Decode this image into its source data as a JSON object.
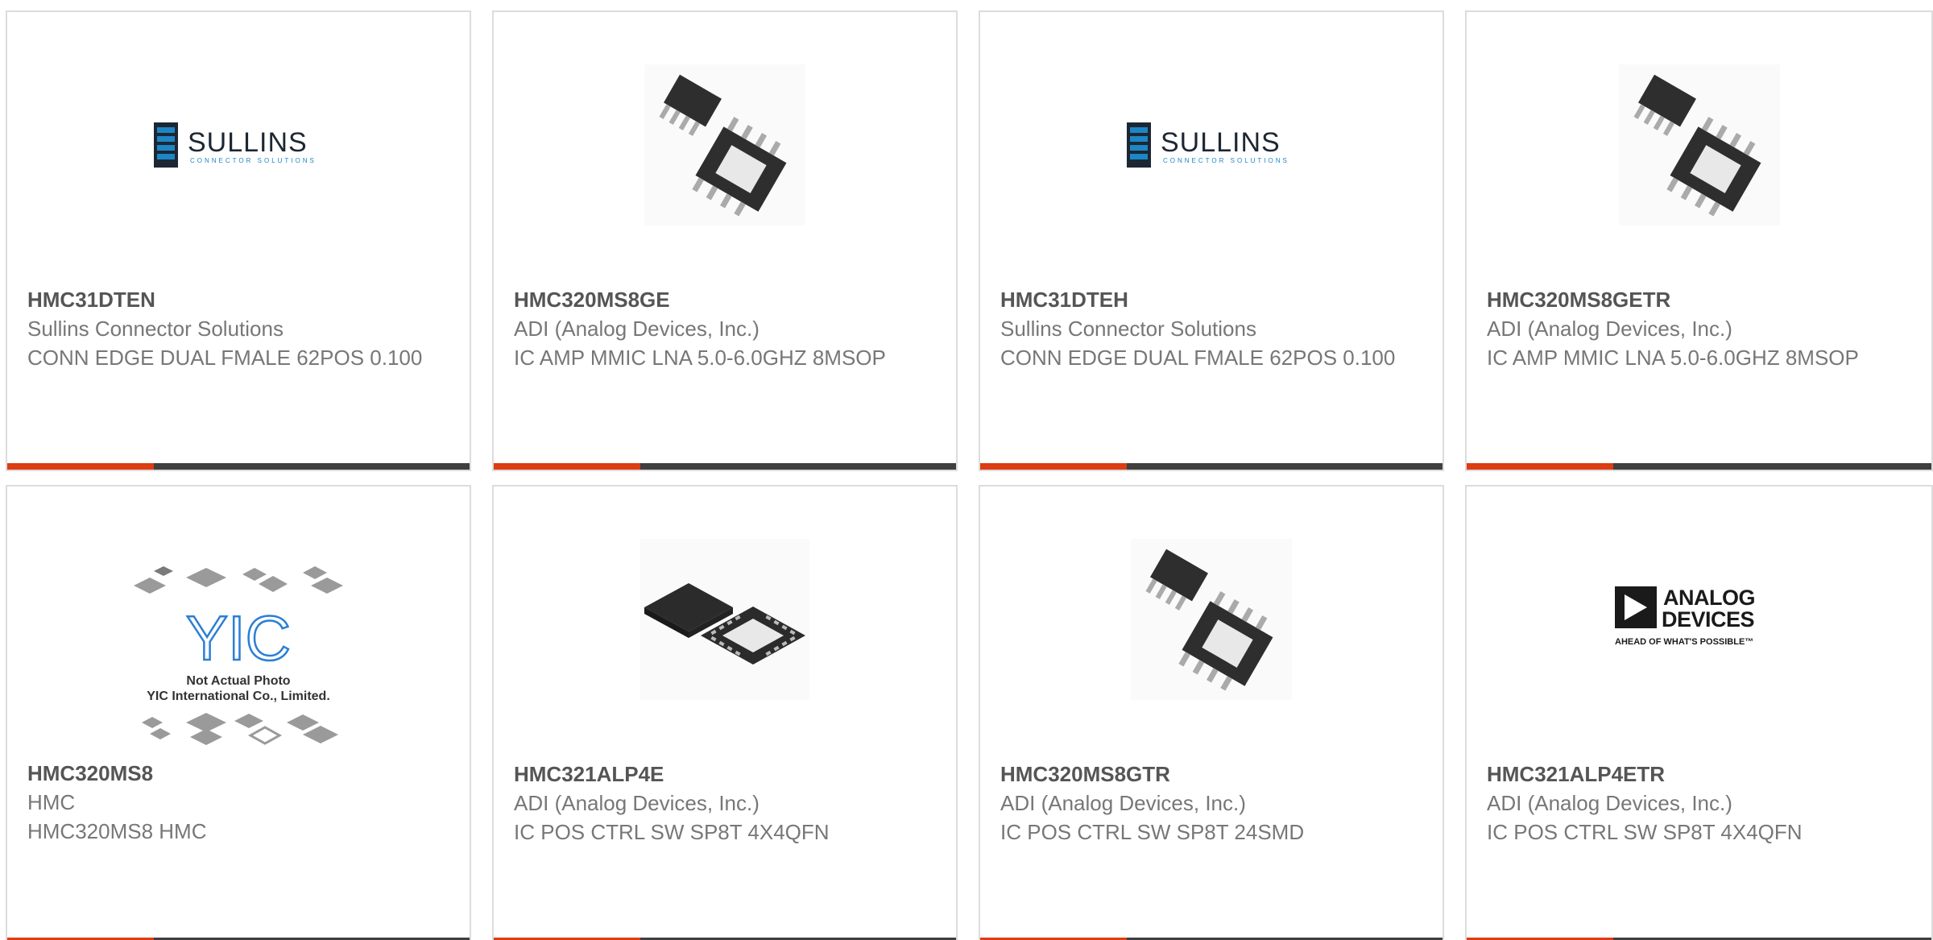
{
  "colors": {
    "accent": "#dc3d12",
    "bar": "#3f3f3f",
    "sullins_blue": "#1d86c6",
    "text_primary": "#555555",
    "text_secondary": "#777777"
  },
  "products": [
    {
      "part": "HMC31DTEN",
      "manufacturer": "Sullins Connector Solutions",
      "description": "CONN EDGE DUAL FMALE 62POS 0.100",
      "image": "sullins-logo"
    },
    {
      "part": "HMC320MS8GE",
      "manufacturer": "ADI (Analog Devices, Inc.)",
      "description": "IC AMP MMIC LNA 5.0-6.0GHZ 8MSOP",
      "image": "msop8-chip"
    },
    {
      "part": "HMC31DTEH",
      "manufacturer": "Sullins Connector Solutions",
      "description": "CONN EDGE DUAL FMALE 62POS 0.100",
      "image": "sullins-logo"
    },
    {
      "part": "HMC320MS8GETR",
      "manufacturer": "ADI (Analog Devices, Inc.)",
      "description": "IC AMP MMIC LNA 5.0-6.0GHZ 8MSOP",
      "image": "msop8-chip"
    },
    {
      "part": "HMC320MS8",
      "manufacturer": "HMC",
      "description": "HMC320MS8 HMC",
      "image": "yic-placeholder"
    },
    {
      "part": "HMC321ALP4E",
      "manufacturer": "ADI (Analog Devices, Inc.)",
      "description": "IC POS CTRL SW SP8T 4X4QFN",
      "image": "qfn-chip"
    },
    {
      "part": "HMC320MS8GTR",
      "manufacturer": "ADI (Analog Devices, Inc.)",
      "description": "IC POS CTRL SW SP8T 24SMD",
      "image": "msop8-chip"
    },
    {
      "part": "HMC321ALP4ETR",
      "manufacturer": "ADI (Analog Devices, Inc.)",
      "description": "IC POS CTRL SW SP8T 4X4QFN",
      "image": "analog-devices-logo"
    }
  ],
  "logos": {
    "sullins_name": "SULLINS",
    "sullins_tagline": "CONNECTOR SOLUTIONS",
    "adi_line1": "ANALOG",
    "adi_line2": "DEVICES",
    "adi_tagline": "AHEAD OF WHAT'S POSSIBLE™",
    "yic_mark": "YIC",
    "yic_line1": "Not Actual Photo",
    "yic_line2": "YIC International Co., Limited."
  }
}
